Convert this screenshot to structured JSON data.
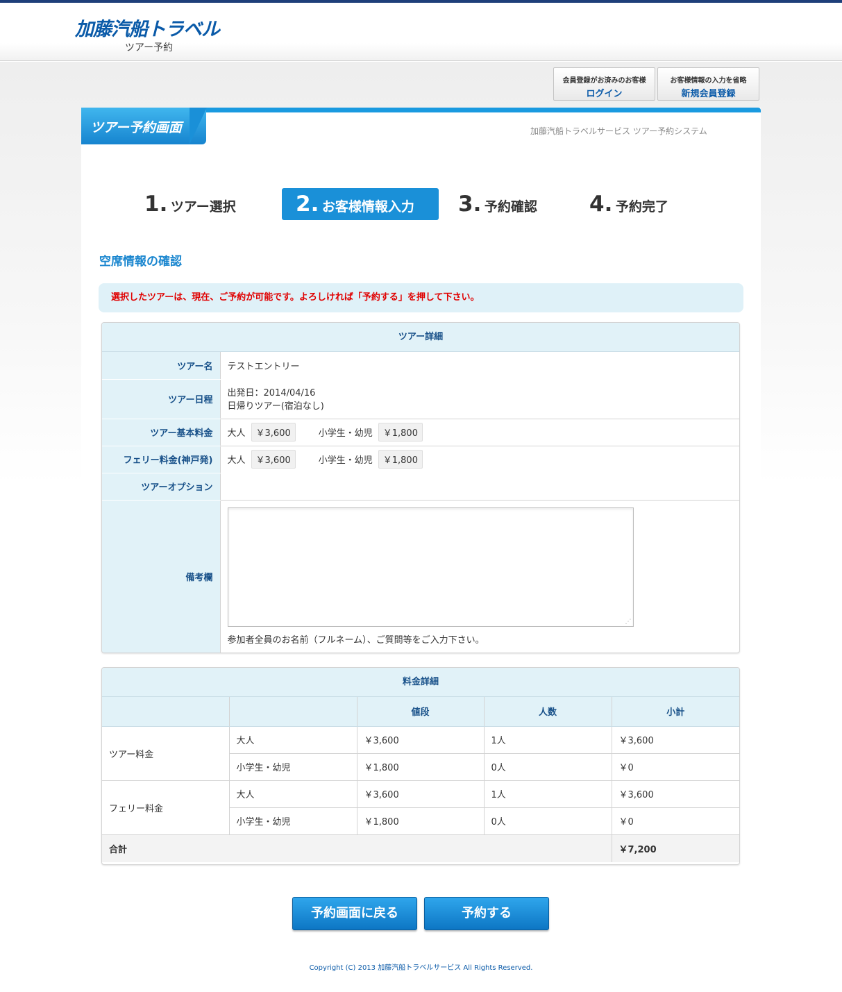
{
  "header": {
    "logo": "加藤汽船トラベル",
    "subtitle": "ツアー予約"
  },
  "account": {
    "login_note": "会員登録がお済みのお客様",
    "login_label": "ログイン",
    "register_note": "お客様情報の入力を省略",
    "register_label": "新規会員登録"
  },
  "panel": {
    "title": "ツアー予約画面",
    "subtitle": "加藤汽船トラベルサービス ツアー予約システム"
  },
  "steps": [
    {
      "num": "1.",
      "label": "ツアー選択"
    },
    {
      "num": "2.",
      "label": "お客様情報入力"
    },
    {
      "num": "3.",
      "label": "予約確認"
    },
    {
      "num": "4.",
      "label": "予約完了"
    }
  ],
  "section_title": "空席情報の確認",
  "notice": "選択したツアーは、現在、ご予約が可能です。よろしければ「予約する」を押して下さい。",
  "tour_detail": {
    "heading": "ツアー詳細",
    "name_label": "ツアー名",
    "name_value": "テストエントリー",
    "schedule_label": "ツアー日程",
    "schedule_line1": "出発日：2014/04/16",
    "schedule_line2": "日帰りツアー(宿泊なし)",
    "base_fee_label": "ツアー基本料金",
    "ferry_fee_label": "フェリー料金(神戸発)",
    "adult_label": "大人",
    "child_label": "小学生・幼児",
    "base_adult_price": "￥3,600",
    "base_child_price": "￥1,800",
    "ferry_adult_price": "￥3,600",
    "ferry_child_price": "￥1,800",
    "option_label": "ツアーオプション",
    "memo_label": "備考欄",
    "memo_hint": "参加者全員のお名前（フルネーム）、ご質問等をご入力下さい。"
  },
  "fee_detail": {
    "heading": "料金詳細",
    "columns": [
      "",
      "",
      "値段",
      "人数",
      "小計"
    ],
    "groups": [
      {
        "name": "ツアー料金",
        "rows": [
          {
            "type": "大人",
            "price": "￥3,600",
            "count": "1人",
            "subtotal": "￥3,600"
          },
          {
            "type": "小学生・幼児",
            "price": "￥1,800",
            "count": "0人",
            "subtotal": "￥0"
          }
        ]
      },
      {
        "name": "フェリー料金",
        "rows": [
          {
            "type": "大人",
            "price": "￥3,600",
            "count": "1人",
            "subtotal": "￥3,600"
          },
          {
            "type": "小学生・幼児",
            "price": "￥1,800",
            "count": "0人",
            "subtotal": "￥0"
          }
        ]
      }
    ],
    "total_label": "合計",
    "total_value": "￥7,200"
  },
  "buttons": {
    "back": "予約画面に戻る",
    "submit": "予約する"
  },
  "footer": "Copyright (C) 2013 加藤汽船トラベルサービス All Rights Reserved."
}
